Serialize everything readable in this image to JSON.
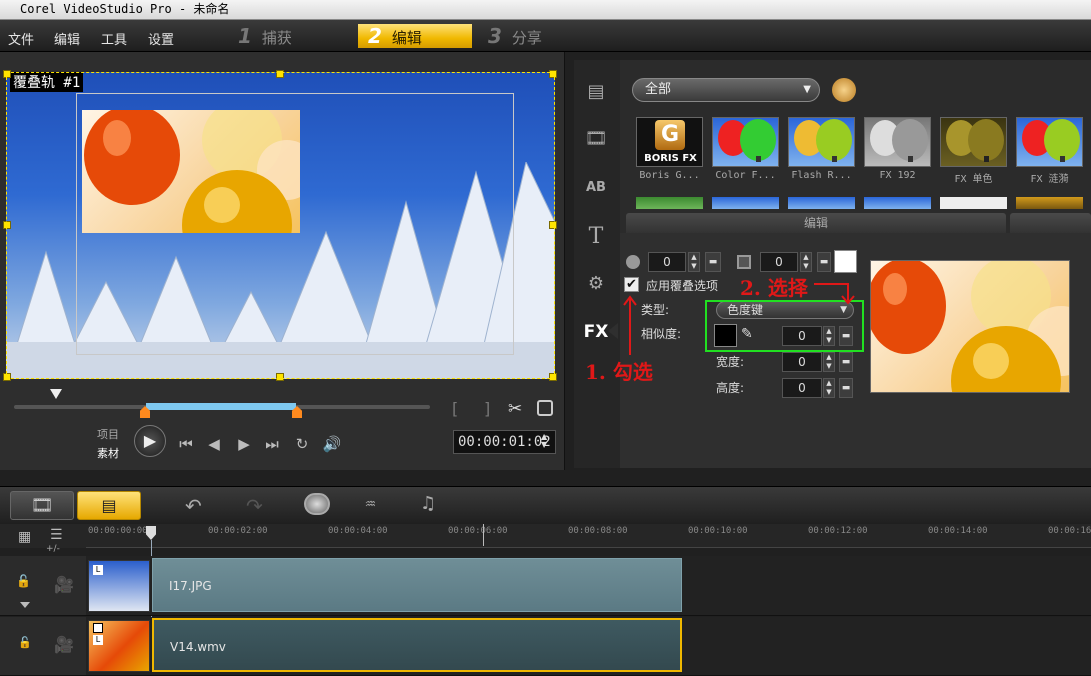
{
  "window": {
    "title": "Corel VideoStudio Pro - 未命名"
  },
  "menu": [
    "文件",
    "编辑",
    "工具",
    "设置"
  ],
  "steps": [
    {
      "num": "1",
      "label": "捕获"
    },
    {
      "num": "2",
      "label": "编辑"
    },
    {
      "num": "3",
      "label": "分享"
    }
  ],
  "preview": {
    "overlay_label": "覆叠轨 #1",
    "timecode": "00:00:01:02",
    "mode_project": "项目",
    "mode_clip": "素材",
    "bracket_in": "[",
    "bracket_out": "]"
  },
  "fx": {
    "category": "全部",
    "thumbs": [
      {
        "caption": "Boris G...",
        "logo": "G",
        "logo_sub": "BORIS FX"
      },
      {
        "caption": "Color F..."
      },
      {
        "caption": "Flash R..."
      },
      {
        "caption": "FX 192"
      },
      {
        "caption": "FX 单色"
      },
      {
        "caption": "FX 涟漪"
      }
    ],
    "tab_label": "编辑",
    "sidebar_label_fx": "FX",
    "opacity_value": "0",
    "border_value": "0",
    "border_color": "#ffffff",
    "apply_overlay_label": "应用覆叠选项",
    "apply_overlay_checked": true,
    "type_label": "类型:",
    "type_value": "色度键",
    "similarity_label": "相似度:",
    "similarity_value": "0",
    "key_color": "#000000",
    "width_label": "宽度:",
    "width_value": "0",
    "height_label": "高度:",
    "height_value": "0"
  },
  "annotations": {
    "step1": "1. 勾选",
    "step2": "2. 选择"
  },
  "timeline": {
    "ticks": [
      "00:00:00:00",
      "00:00:02:00",
      "00:00:04:00",
      "00:00:06:00",
      "00:00:08:00",
      "00:00:10:00",
      "00:00:12:00",
      "00:00:14:00",
      "00:00:16:"
    ],
    "zoom_label": "+/-",
    "overlay_clip": "I17.JPG",
    "video_clip": "V14.wmv",
    "clip_badge": "L"
  },
  "colors": {
    "accent": "#f0b800",
    "annotation": "#e01818",
    "highlight_box": "#21e021"
  }
}
